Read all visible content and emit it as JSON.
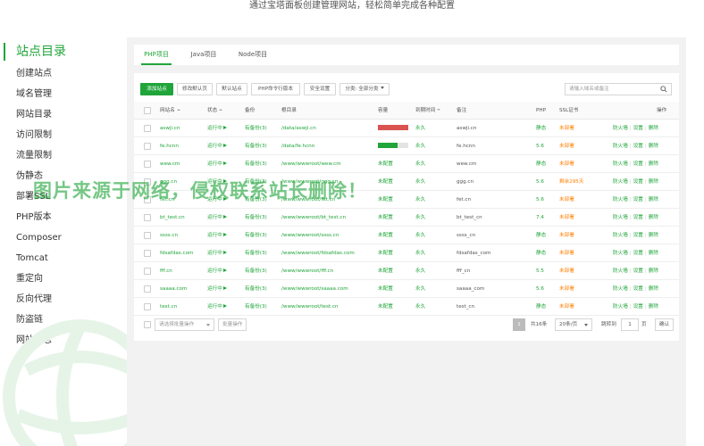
{
  "header": {
    "tagline": "通过宝塔面板创建管理网站，轻松简单完成各种配置"
  },
  "sidebar": {
    "title": "站点目录",
    "items": [
      "创建站点",
      "域名管理",
      "网站目录",
      "访问限制",
      "流量限制",
      "伪静态",
      "部署SSL",
      "PHP版本",
      "Composer",
      "Tomcat",
      "重定向",
      "反向代理",
      "防盗链",
      "网站日志"
    ]
  },
  "tabs": [
    "PHP项目",
    "Java项目",
    "Node项目"
  ],
  "toolbar": {
    "add_site": "添加站点",
    "modify_default_page": "修改默认页",
    "default_site": "默认站点",
    "php_cli_version": "PHP命令行版本",
    "security_settings": "安全设置",
    "category_label": "分类: 全部分类",
    "search_placeholder": "请输入域名或备注"
  },
  "table": {
    "headers": {
      "site_name": "网站名",
      "status": "状态",
      "backup": "备份",
      "root": "根目录",
      "capacity": "容量",
      "expire": "到期时间",
      "remark": "备注",
      "php": "PHP",
      "ssl": "SSL证书",
      "actions": "操作"
    },
    "rows": [
      {
        "name": "aswji.cn",
        "status": "运行中",
        "backup": "有备份(3)",
        "root": "/data/aswji.cn",
        "capacity": "",
        "capacity_fill": 1.0,
        "capacity_color": "#d9534f",
        "expire": "永久",
        "remark": "aswji.cn",
        "php": "静态",
        "ssl": "未部署"
      },
      {
        "name": "fe.hcnn",
        "status": "运行中",
        "backup": "有备份(3)",
        "root": "/data/fe.hcnn",
        "capacity": "",
        "capacity_fill": 0.65,
        "capacity_color": "#20a53a",
        "expire": "永久",
        "remark": "fe.hcnn",
        "php": "5.6",
        "ssl": "未部署"
      },
      {
        "name": "wew.cm",
        "status": "运行中",
        "backup": "有备份(3)",
        "root": "/www/wwwroot/wew.cm",
        "capacity": "未配置",
        "capacity_fill": null,
        "capacity_color": "",
        "expire": "永久",
        "remark": "wew.cm",
        "php": "静态",
        "ssl": "未部署"
      },
      {
        "name": "ggg.cn",
        "status": "运行中",
        "backup": "有备份(3)",
        "root": "/www/wwwroot/ggg.cn",
        "capacity": "未配置",
        "capacity_fill": null,
        "capacity_color": "",
        "expire": "永久",
        "remark": "ggg.cn",
        "php": "5.6",
        "ssl": "剩余295天"
      },
      {
        "name": "fet.cn",
        "status": "运行中",
        "backup": "有备份(3)",
        "root": "/www/wwwroot/fet.cn",
        "capacity": "未配置",
        "capacity_fill": null,
        "capacity_color": "",
        "expire": "永久",
        "remark": "fet.cn",
        "php": "5.6",
        "ssl": "未部署"
      },
      {
        "name": "bt_test.cn",
        "status": "运行中",
        "backup": "有备份(3)",
        "root": "/www/wwwroot/bt_test.cn",
        "capacity": "未配置",
        "capacity_fill": null,
        "capacity_color": "",
        "expire": "永久",
        "remark": "bt_test_cn",
        "php": "7.4",
        "ssl": "未部署"
      },
      {
        "name": "ssss.cn",
        "status": "运行中",
        "backup": "有备份(3)",
        "root": "/www/wwwroot/ssss.cn",
        "capacity": "未配置",
        "capacity_fill": null,
        "capacity_color": "",
        "expire": "永久",
        "remark": "ssss_cn",
        "php": "静态",
        "ssl": "未部署"
      },
      {
        "name": "fdsafdas.com",
        "status": "运行中",
        "backup": "有备份(3)",
        "root": "/www/wwwroot/fdsafdas.com",
        "capacity": "未配置",
        "capacity_fill": null,
        "capacity_color": "",
        "expire": "永久",
        "remark": "fdsafdas_com",
        "php": "静态",
        "ssl": "未部署"
      },
      {
        "name": "fff.cn",
        "status": "运行中",
        "backup": "有备份(3)",
        "root": "/www/wwwroot/fff.cn",
        "capacity": "未配置",
        "capacity_fill": null,
        "capacity_color": "",
        "expire": "永久",
        "remark": "fff_cn",
        "php": "5.5",
        "ssl": "未部署"
      },
      {
        "name": "saaaa.com",
        "status": "运行中",
        "backup": "有备份(3)",
        "root": "/www/wwwroot/saaaa.com",
        "capacity": "未配置",
        "capacity_fill": null,
        "capacity_color": "",
        "expire": "永久",
        "remark": "saaaa_com",
        "php": "5.6",
        "ssl": "未部署"
      },
      {
        "name": "test.cn",
        "status": "运行中",
        "backup": "有备份(3)",
        "root": "/www/wwwroot/test.cn",
        "capacity": "未配置",
        "capacity_fill": null,
        "capacity_color": "",
        "expire": "永久",
        "remark": "test_cn",
        "php": "静态",
        "ssl": "未部署"
      }
    ],
    "actions": {
      "firewall": "防火墙",
      "settings": "设置",
      "delete": "删除",
      "separator": "|"
    }
  },
  "footer": {
    "batch_select": "请选择批量操作",
    "batch_button": "批量操作",
    "page": "1",
    "total": "共16条",
    "per_page": "20条/页",
    "jump_label": "跳转到",
    "jump_value": "1",
    "page_unit": "页",
    "confirm": "确认"
  },
  "watermark": "图片来源于网络，侵权联系站长删除！",
  "colors": {
    "accent": "#20a53a",
    "warning": "#ff7f00",
    "danger": "#d9534f"
  }
}
